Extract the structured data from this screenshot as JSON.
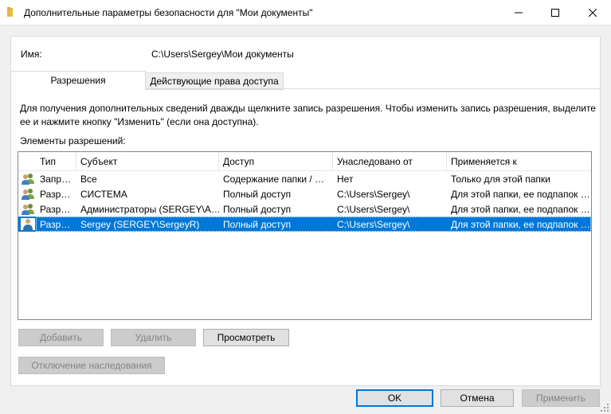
{
  "window": {
    "title": "Дополнительные параметры безопасности  для \"Мои документы\"",
    "icon": "folder-icon",
    "controls": [
      "minimize-icon",
      "maximize-icon",
      "close-icon"
    ]
  },
  "name_row": {
    "label": "Имя:",
    "value": "C:\\Users\\Sergey\\Мои документы"
  },
  "tabs": [
    {
      "label": "Разрешения",
      "active": true
    },
    {
      "label": "Действующие права доступа",
      "active": false
    }
  ],
  "info_text": "Для получения дополнительных сведений дважды щелкните запись разрешения. Чтобы изменить запись разрешения, выделите ее и нажмите кнопку \"Изменить\" (если она доступна).",
  "list_caption": "Элементы разрешений:",
  "columns": [
    "Тип",
    "Субъект",
    "Доступ",
    "Унаследовано от",
    "Применяется к"
  ],
  "rows": [
    {
      "icon": "users-group-icon",
      "type": "Запр…",
      "subject": "Все",
      "access": "Содержание папки / …",
      "inherited": "Нет",
      "applies": "Только для этой папки",
      "selected": false
    },
    {
      "icon": "users-group-icon",
      "type": "Разр…",
      "subject": "СИСТЕМА",
      "access": "Полный доступ",
      "inherited": "C:\\Users\\Sergey\\",
      "applies": "Для этой папки, ее подпапок …",
      "selected": false
    },
    {
      "icon": "users-group-icon",
      "type": "Разр…",
      "subject": "Администраторы (SERGEY\\А…",
      "access": "Полный доступ",
      "inherited": "C:\\Users\\Sergey\\",
      "applies": "Для этой папки, ее подпапок …",
      "selected": false
    },
    {
      "icon": "user-icon",
      "type": "Разр…",
      "subject": "Sergey (SERGEY\\SergeyR)",
      "access": "Полный доступ",
      "inherited": "C:\\Users\\Sergey\\",
      "applies": "Для этой папки, ее подпапок …",
      "selected": true
    }
  ],
  "buttons": {
    "add": "Добавить",
    "remove": "Удалить",
    "view": "Просмотреть",
    "disable_inheritance": "Отключение наследования",
    "ok": "OK",
    "cancel": "Отмена",
    "apply": "Применить"
  },
  "colors": {
    "selection": "#0078d7",
    "default_button_border": "#0078d7"
  }
}
